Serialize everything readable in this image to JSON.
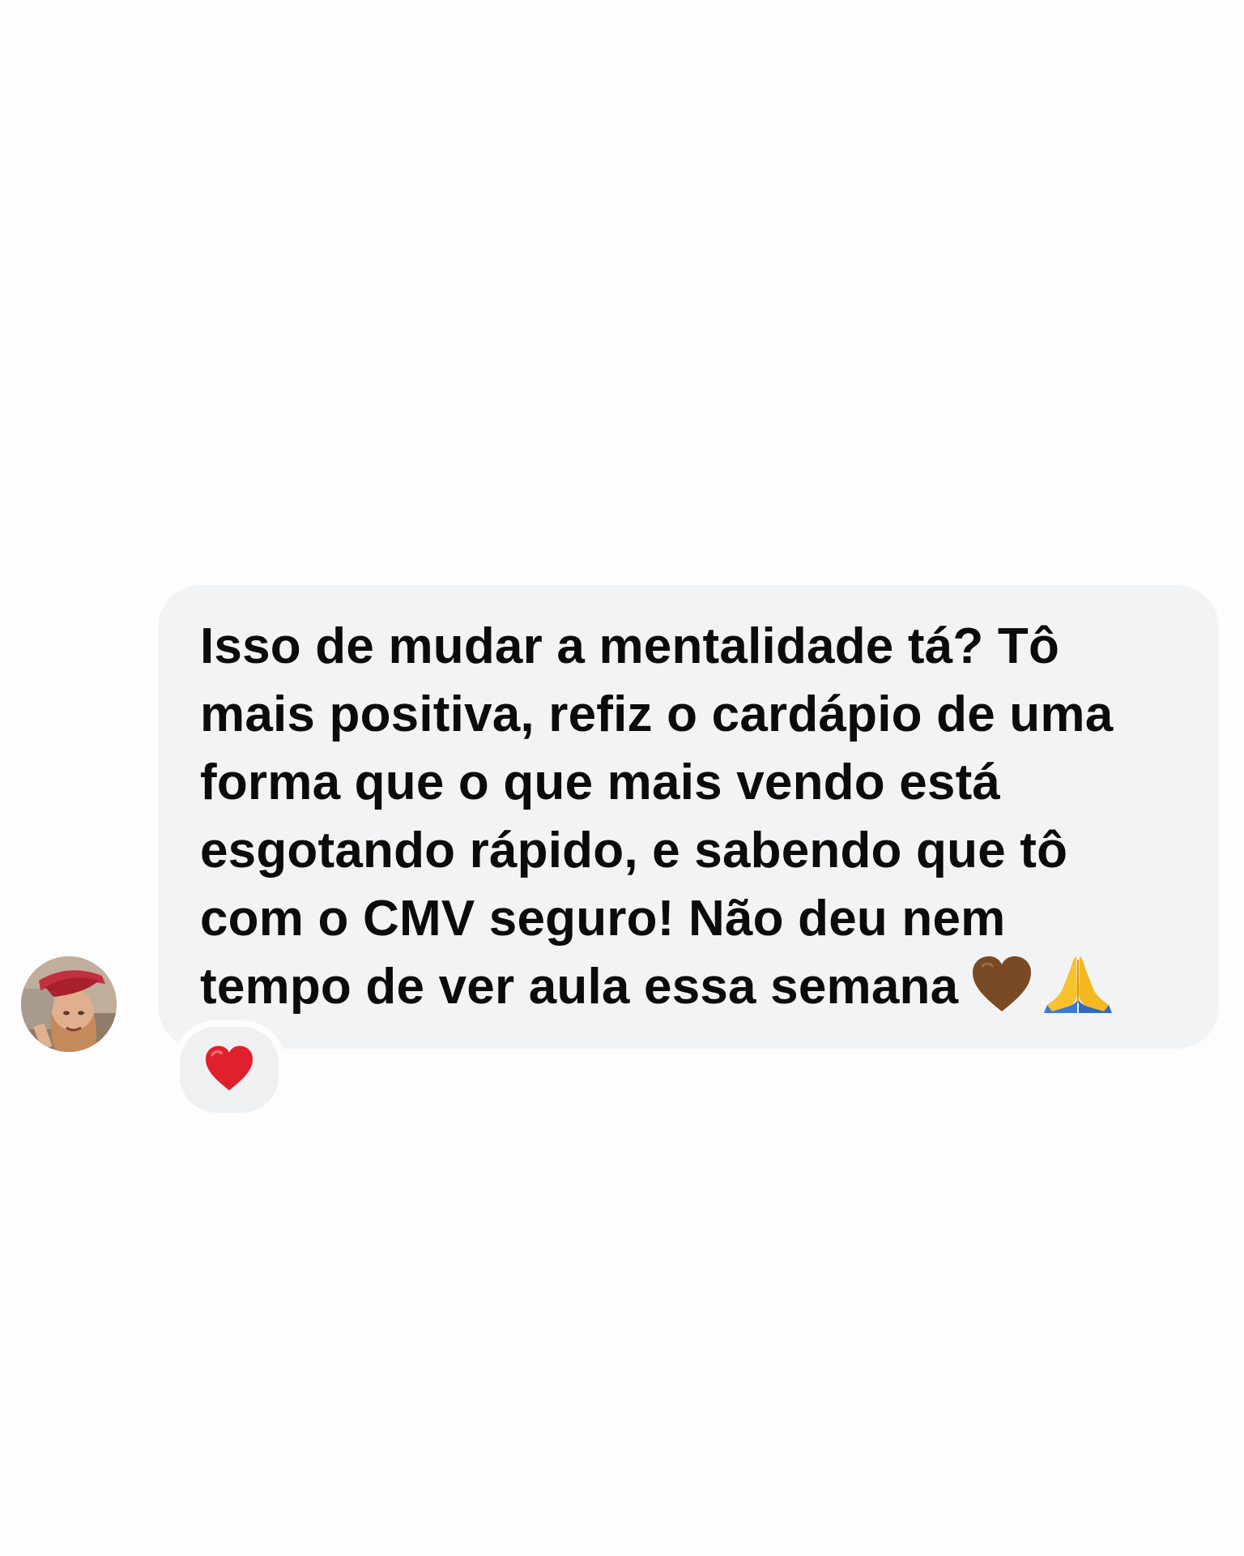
{
  "message": {
    "lines": [
      "Isso de mudar a mentalidade tá? Tô",
      "mais positiva, refiz o cardápio de uma",
      "forma que o que mais vendo está",
      "esgotando rápido, e sabendo que tô",
      "com o CMV seguro! Não deu nem",
      "tempo de ver aula essa semana"
    ],
    "trailing_emoji": [
      "brown-heart-icon",
      "folded-hands-icon"
    ]
  },
  "reaction": {
    "emoji": "red-heart-icon"
  },
  "sender": {
    "avatar": "profile-photo"
  },
  "colors": {
    "bubble": "#f2f3f5",
    "text": "#0b0b0b",
    "background": "#fdfdfd",
    "red_heart": "#e0202c",
    "brown_heart": "#7a4a24"
  }
}
